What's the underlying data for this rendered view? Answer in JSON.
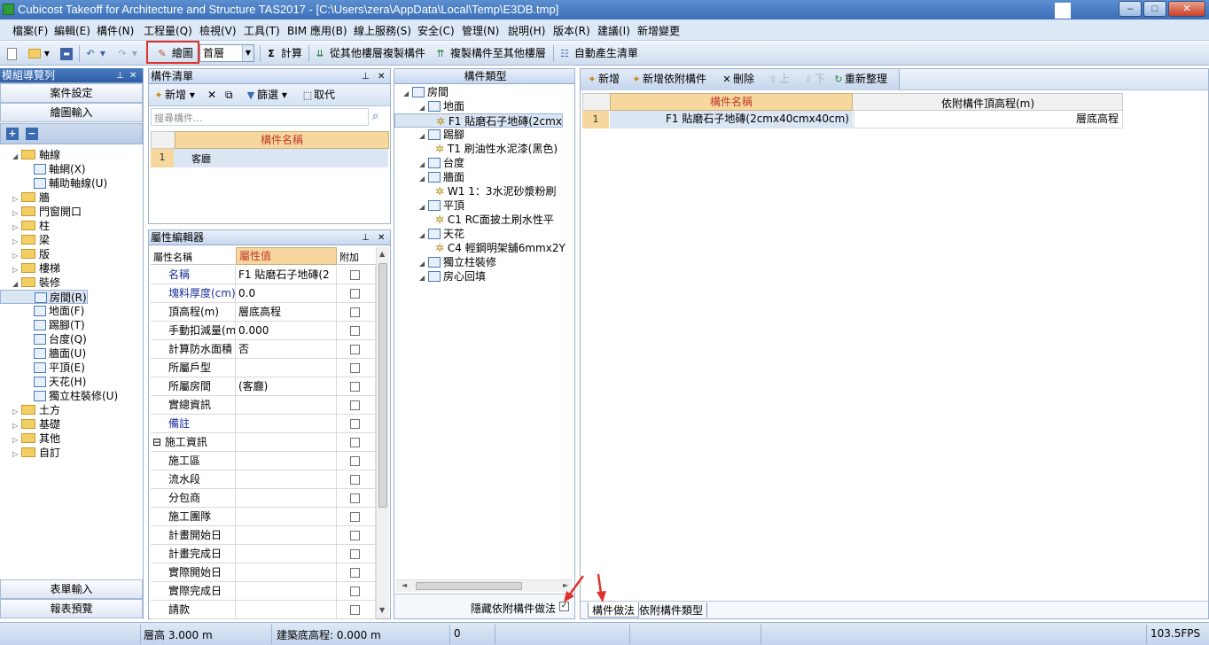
{
  "window": {
    "title": "Cubicost Takeoff for Architecture and Structure TAS2017 - [C:\\Users\\zera\\AppData\\Local\\Temp\\E3DB.tmp]",
    "min": "–",
    "max": "□",
    "close": "✕"
  },
  "menu": [
    "檔案(F)",
    "編輯(E)",
    "構件(N)",
    "工程量(Q)",
    "檢視(V)",
    "工具(T)",
    "BIM 應用(B)",
    "線上服務(S)",
    "安全(C)",
    "管理(N)",
    "說明(H)",
    "版本(R)",
    "建議(I)",
    "新增變更"
  ],
  "toolbar": {
    "draw": "繪圖",
    "floor": "首層",
    "calc": "計算",
    "copy_from": "從其他樓層複製構件",
    "copy_to": "複製構件至其他樓層",
    "auto_list": "自動產生清單"
  },
  "left": {
    "title": "模組導覽列",
    "btn_case": "案件設定",
    "btn_draw": "繪圖輸入",
    "btn_table": "表單輸入",
    "btn_report": "報表預覽",
    "tree": [
      {
        "label": "軸線",
        "level": 0,
        "type": "folder",
        "open": true
      },
      {
        "label": "軸網(X)",
        "level": 1,
        "type": "item"
      },
      {
        "label": "輔助軸線(U)",
        "level": 1,
        "type": "item"
      },
      {
        "label": "牆",
        "level": 0,
        "type": "folder"
      },
      {
        "label": "門窗開口",
        "level": 0,
        "type": "folder"
      },
      {
        "label": "柱",
        "level": 0,
        "type": "folder"
      },
      {
        "label": "梁",
        "level": 0,
        "type": "folder"
      },
      {
        "label": "版",
        "level": 0,
        "type": "folder"
      },
      {
        "label": "樓梯",
        "level": 0,
        "type": "folder"
      },
      {
        "label": "裝修",
        "level": 0,
        "type": "folder",
        "open": true
      },
      {
        "label": "房間(R)",
        "level": 1,
        "type": "item",
        "selected": true
      },
      {
        "label": "地面(F)",
        "level": 1,
        "type": "item"
      },
      {
        "label": "踢腳(T)",
        "level": 1,
        "type": "item"
      },
      {
        "label": "台度(Q)",
        "level": 1,
        "type": "item"
      },
      {
        "label": "牆面(U)",
        "level": 1,
        "type": "item"
      },
      {
        "label": "平頂(E)",
        "level": 1,
        "type": "item"
      },
      {
        "label": "天花(H)",
        "level": 1,
        "type": "item"
      },
      {
        "label": "獨立柱裝修(U)",
        "level": 1,
        "type": "item"
      },
      {
        "label": "土方",
        "level": 0,
        "type": "folder"
      },
      {
        "label": "基礎",
        "level": 0,
        "type": "folder"
      },
      {
        "label": "其他",
        "level": 0,
        "type": "folder"
      },
      {
        "label": "自訂",
        "level": 0,
        "type": "folder"
      }
    ]
  },
  "complist": {
    "title": "構件清單",
    "new": "新增",
    "filter": "篩選",
    "pick": "取代",
    "search_placeholder": "搜尋構件...",
    "col_name": "構件名稱",
    "rows": [
      {
        "no": "1",
        "name": "客廳"
      }
    ]
  },
  "props": {
    "title": "屬性編輯器",
    "col_name": "屬性名稱",
    "col_value": "屬性值",
    "col_add": "附加",
    "rows": [
      {
        "name": "名稱",
        "value": "F1 貼磨石子地磚(2",
        "blue": true
      },
      {
        "name": "塊料厚度(cm)",
        "value": "0.0",
        "blue": true
      },
      {
        "name": "頂高程(m)",
        "value": "層底高程"
      },
      {
        "name": "手動扣減量(m",
        "value": "0.000"
      },
      {
        "name": "計算防水面積",
        "value": "否"
      },
      {
        "name": "所屬戶型",
        "value": ""
      },
      {
        "name": "所屬房間",
        "value": "(客廳)"
      },
      {
        "name": "實總資訊",
        "value": ""
      },
      {
        "name": "備註",
        "value": "",
        "blue": true
      },
      {
        "name": "施工資訊",
        "value": "",
        "group": true
      },
      {
        "name": "施工區",
        "value": "",
        "sub": true
      },
      {
        "name": "流水段",
        "value": "",
        "sub": true
      },
      {
        "name": "分包商",
        "value": "",
        "sub": true
      },
      {
        "name": "施工團隊",
        "value": "",
        "sub": true
      },
      {
        "name": "計畫開始日",
        "value": "",
        "sub": true
      },
      {
        "name": "計畫完成日",
        "value": "",
        "sub": true
      },
      {
        "name": "實際開始日",
        "value": "",
        "sub": true
      },
      {
        "name": "實際完成日",
        "value": "",
        "sub": true
      },
      {
        "name": "請款",
        "value": "",
        "sub": true
      }
    ]
  },
  "types": {
    "title": "構件類型",
    "hide_label": "隱藏依附構件做法",
    "tree": [
      {
        "label": "房間",
        "level": 0
      },
      {
        "label": "地面",
        "level": 1
      },
      {
        "label": "F1 貼磨石子地磚(2cmx",
        "level": 2,
        "selected": true
      },
      {
        "label": "踢腳",
        "level": 1
      },
      {
        "label": "T1 刷油性水泥漆(黑色)",
        "level": 2
      },
      {
        "label": "台度",
        "level": 1
      },
      {
        "label": "牆面",
        "level": 1
      },
      {
        "label": "W1 1：3水泥砂漿粉刷",
        "level": 2
      },
      {
        "label": "平頂",
        "level": 1
      },
      {
        "label": "C1 RC面披土刷水性平",
        "level": 2
      },
      {
        "label": "天花",
        "level": 1
      },
      {
        "label": "C4 輕鋼明架舖6mmx2Y",
        "level": 2
      },
      {
        "label": "獨立柱裝修",
        "level": 1
      },
      {
        "label": "房心回填",
        "level": 1
      }
    ]
  },
  "right": {
    "new": "新增",
    "new_dep": "新增依附構件",
    "delete": "刪除",
    "up": "上",
    "down": "下",
    "reorg": "重新整理",
    "col_name": "構件名稱",
    "col_height": "依附構件頂高程(m)",
    "rows": [
      {
        "no": "1",
        "name": "F1 貼磨石子地磚(2cmx40cmx40cm)",
        "height": "層底高程"
      }
    ],
    "tab1": "構件做法",
    "tab2": "依附構件類型"
  },
  "status": {
    "floor_height": "層高 3.000 m",
    "base_elev": "建築底高程: 0.000 m",
    "value": "0",
    "fps": "103.5FPS"
  }
}
